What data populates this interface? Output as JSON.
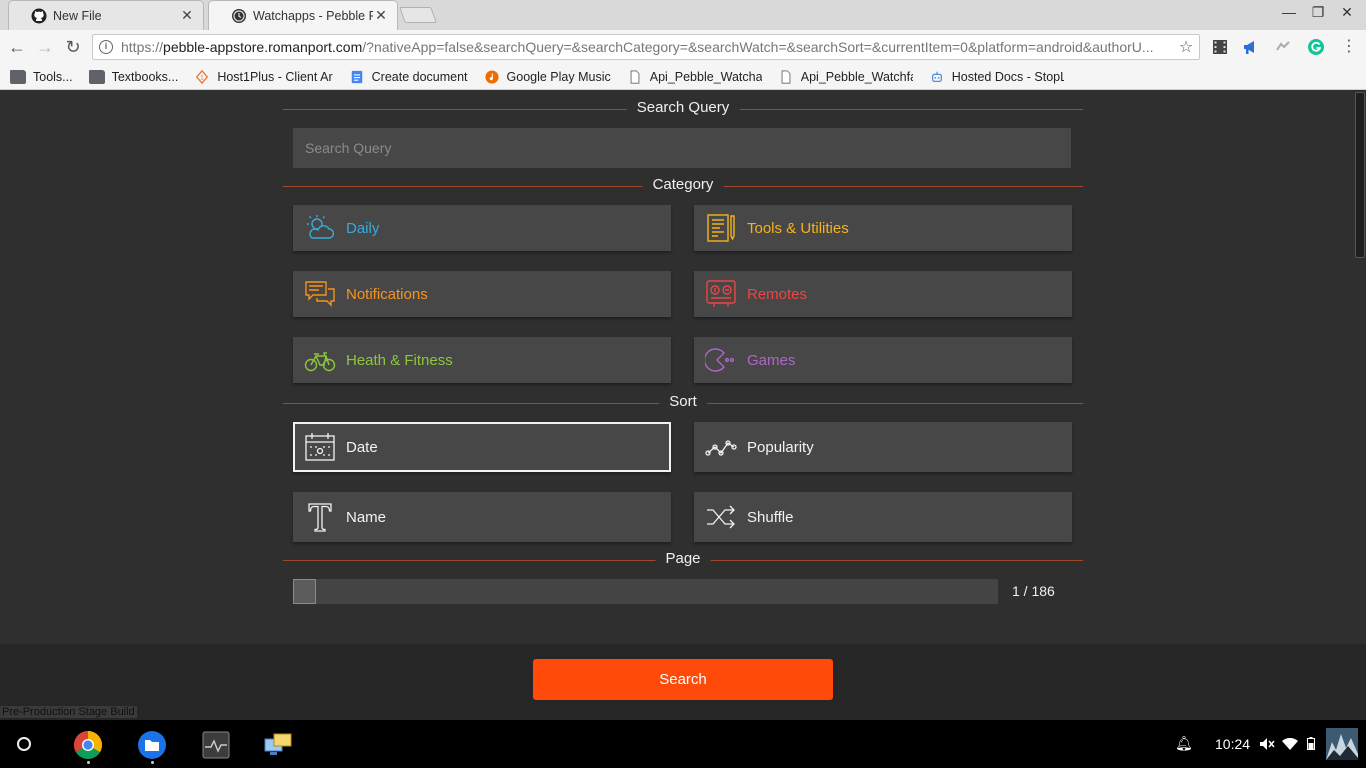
{
  "browser": {
    "tabs": [
      {
        "title": "New File",
        "icon": "github-icon"
      },
      {
        "title": "Watchapps - Pebble Ripp",
        "icon": "pebble-clock-icon"
      }
    ],
    "url_prefix": "https://",
    "url_host": "pebble-appstore.romanport.com",
    "url_rest": "/?nativeApp=false&searchQuery=&searchCategory=&searchWatch=&searchSort=&currentItem=0&platform=android&authorU...",
    "bookmarks": [
      {
        "label": "Tools...",
        "icon": "folder-icon"
      },
      {
        "label": "Textbooks...",
        "icon": "folder-icon"
      },
      {
        "label": "Host1Plus - Client Ar",
        "icon": "host1plus-icon"
      },
      {
        "label": "Create document",
        "icon": "google-docs-icon"
      },
      {
        "label": "Google Play Music",
        "icon": "play-music-icon"
      },
      {
        "label": "Api_Pebble_Watchap",
        "icon": "page-icon"
      },
      {
        "label": "Api_Pebble_Watchfa",
        "icon": "page-icon"
      },
      {
        "label": "Hosted Docs - StopLi",
        "icon": "robot-icon"
      }
    ]
  },
  "page": {
    "sections": {
      "query": "Search Query",
      "category": "Category",
      "sort": "Sort",
      "page": "Page"
    },
    "search_placeholder": "Search Query",
    "categories": [
      {
        "label": "Daily",
        "color": "#3aa9dc",
        "icon": "cloud-sun-icon"
      },
      {
        "label": "Tools & Utilities",
        "color": "#f5b21b",
        "icon": "tools-notepad-icon"
      },
      {
        "label": "Notifications",
        "color": "#f7941d",
        "icon": "chat-bubbles-icon"
      },
      {
        "label": "Remotes",
        "color": "#ef4444",
        "icon": "remote-icon"
      },
      {
        "label": "Heath & Fitness",
        "color": "#8dc63f",
        "icon": "bicycle-icon"
      },
      {
        "label": "Games",
        "color": "#b066c9",
        "icon": "pacman-icon"
      }
    ],
    "sorts": [
      {
        "label": "Date",
        "icon": "calendar-icon",
        "selected": true
      },
      {
        "label": "Popularity",
        "icon": "trend-line-icon",
        "selected": false
      },
      {
        "label": "Name",
        "icon": "typography-t-icon",
        "selected": false
      },
      {
        "label": "Shuffle",
        "icon": "shuffle-icon",
        "selected": false
      }
    ],
    "page_current": 1,
    "page_total": 186,
    "page_label": "1 / 186",
    "search_button": "Search",
    "build_label": "Pre-Production Stage Build",
    "accent_color": "#ff4a0a",
    "divider_color": "#a0482a"
  },
  "shelf": {
    "time": "10:24"
  }
}
